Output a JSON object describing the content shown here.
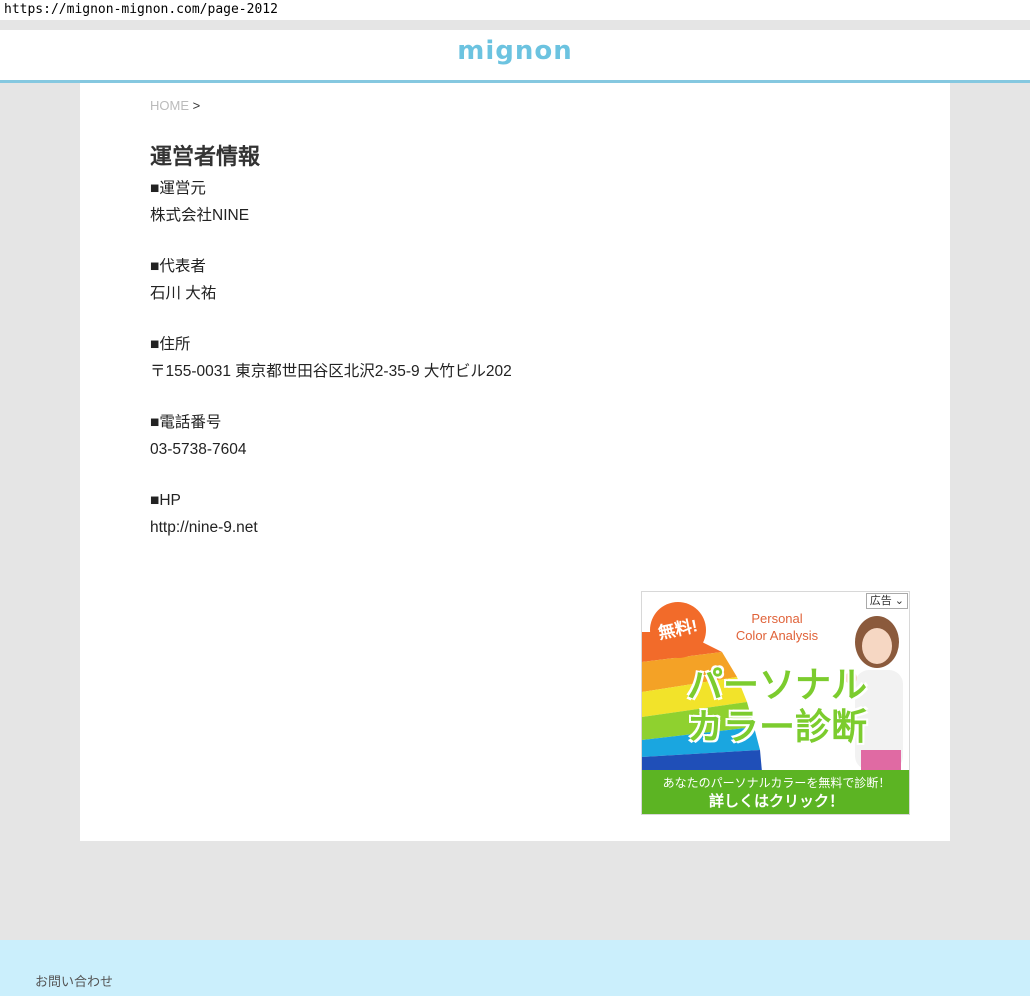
{
  "browser": {
    "url": "https://mignon-mignon.com/page-2012"
  },
  "header": {
    "logo": "mignon"
  },
  "breadcrumb": {
    "home": "HOME",
    "separator": ">"
  },
  "page": {
    "title": "運営者情報",
    "sections": [
      {
        "label": "■運営元",
        "value": "株式会社NINE"
      },
      {
        "label": "■代表者",
        "value": "石川 大祐"
      },
      {
        "label": "■住所",
        "value": "〒155-0031 東京都世田谷区北沢2-35-9 大竹ビル202"
      },
      {
        "label": "■電話番号",
        "value": "03-5738-7604"
      },
      {
        "label": "■HP",
        "value": "http://nine-9.net"
      }
    ]
  },
  "ad": {
    "tag": "広告",
    "badge": "無料!",
    "english_line1": "Personal",
    "english_line2": "Color Analysis",
    "headline_line1": "パーソナル",
    "headline_line2": "カラー診断",
    "bottom_line1": "あなたのパーソナルカラーを無料で診断！",
    "bottom_line2": "詳しくはクリック！"
  },
  "footer": {
    "contact": "お問い合わせ"
  },
  "colors": {
    "accent": "#6cc3e0",
    "header_border": "#85c8e0",
    "footer_bg": "#cbeffc",
    "page_bg": "#e5e5e5",
    "ad_green": "#5cb423"
  }
}
